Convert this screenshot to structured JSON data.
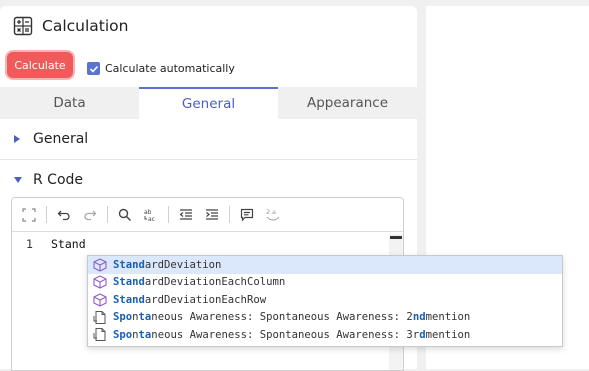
{
  "header": {
    "title": "Calculation",
    "icon": "calculator-icon"
  },
  "actions": {
    "calculate_label": "Calculate",
    "auto_label": "Calculate automatically",
    "auto_checked": true
  },
  "tabs": [
    {
      "label": "Data",
      "active": false
    },
    {
      "label": "General",
      "active": true
    },
    {
      "label": "Appearance",
      "active": false
    }
  ],
  "sections": [
    {
      "label": "General",
      "expanded": false
    },
    {
      "label": "R Code",
      "expanded": true
    }
  ],
  "editor": {
    "toolbar": [
      "expand-icon",
      "undo-icon",
      "redo-icon",
      "search-icon",
      "replace-icon",
      "outdent-icon",
      "indent-icon",
      "comment-icon",
      "format-icon"
    ],
    "lines": [
      {
        "number": "1",
        "text": "Stand"
      }
    ]
  },
  "suggestions": [
    {
      "match": "Stand",
      "rest": "ardDeviation",
      "icon": "function-icon",
      "selected": true
    },
    {
      "match": "Stand",
      "rest": "ardDeviationEachColumn",
      "icon": "function-icon",
      "selected": false
    },
    {
      "match": "Stand",
      "rest": "ardDeviationEachRow",
      "icon": "function-icon",
      "selected": false
    },
    {
      "parts": [
        "",
        "Spo",
        "n",
        "ta",
        "n",
        "eous Awareness: Spontaneous Awareness: 2",
        "nd",
        " mention"
      ],
      "icon": "variable-icon",
      "selected": false
    },
    {
      "parts": [
        "",
        "Spo",
        "n",
        "ta",
        "n",
        "eous Awareness: Spontaneous Awareness: 3r",
        "d",
        " mention"
      ],
      "icon": "variable-icon",
      "selected": false
    }
  ],
  "colors": {
    "accent": "#5b73d0",
    "calculate": "#f05a5a",
    "highlight": "#1a5fb4"
  }
}
